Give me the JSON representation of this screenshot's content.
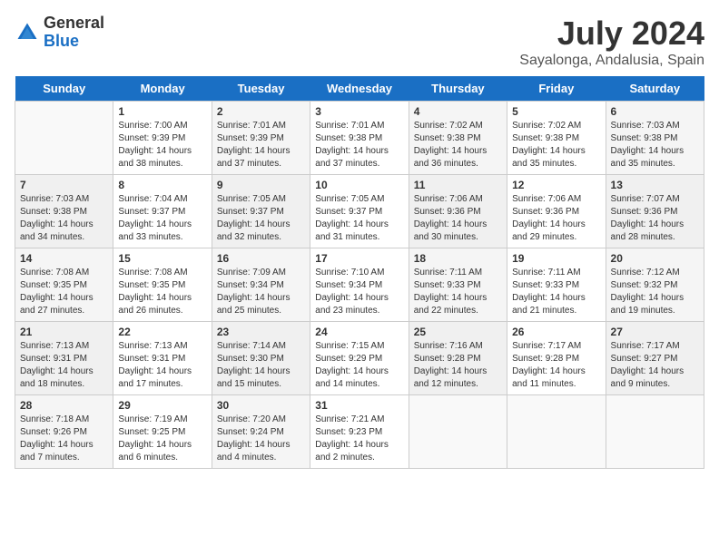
{
  "header": {
    "logo_general": "General",
    "logo_blue": "Blue",
    "title": "July 2024",
    "subtitle": "Sayalonga, Andalusia, Spain"
  },
  "weekdays": [
    "Sunday",
    "Monday",
    "Tuesday",
    "Wednesday",
    "Thursday",
    "Friday",
    "Saturday"
  ],
  "weeks": [
    [
      {
        "day": "",
        "info": ""
      },
      {
        "day": "1",
        "info": "Sunrise: 7:00 AM\nSunset: 9:39 PM\nDaylight: 14 hours\nand 38 minutes."
      },
      {
        "day": "2",
        "info": "Sunrise: 7:01 AM\nSunset: 9:39 PM\nDaylight: 14 hours\nand 37 minutes."
      },
      {
        "day": "3",
        "info": "Sunrise: 7:01 AM\nSunset: 9:38 PM\nDaylight: 14 hours\nand 37 minutes."
      },
      {
        "day": "4",
        "info": "Sunrise: 7:02 AM\nSunset: 9:38 PM\nDaylight: 14 hours\nand 36 minutes."
      },
      {
        "day": "5",
        "info": "Sunrise: 7:02 AM\nSunset: 9:38 PM\nDaylight: 14 hours\nand 35 minutes."
      },
      {
        "day": "6",
        "info": "Sunrise: 7:03 AM\nSunset: 9:38 PM\nDaylight: 14 hours\nand 35 minutes."
      }
    ],
    [
      {
        "day": "7",
        "info": "Sunrise: 7:03 AM\nSunset: 9:38 PM\nDaylight: 14 hours\nand 34 minutes."
      },
      {
        "day": "8",
        "info": "Sunrise: 7:04 AM\nSunset: 9:37 PM\nDaylight: 14 hours\nand 33 minutes."
      },
      {
        "day": "9",
        "info": "Sunrise: 7:05 AM\nSunset: 9:37 PM\nDaylight: 14 hours\nand 32 minutes."
      },
      {
        "day": "10",
        "info": "Sunrise: 7:05 AM\nSunset: 9:37 PM\nDaylight: 14 hours\nand 31 minutes."
      },
      {
        "day": "11",
        "info": "Sunrise: 7:06 AM\nSunset: 9:36 PM\nDaylight: 14 hours\nand 30 minutes."
      },
      {
        "day": "12",
        "info": "Sunrise: 7:06 AM\nSunset: 9:36 PM\nDaylight: 14 hours\nand 29 minutes."
      },
      {
        "day": "13",
        "info": "Sunrise: 7:07 AM\nSunset: 9:36 PM\nDaylight: 14 hours\nand 28 minutes."
      }
    ],
    [
      {
        "day": "14",
        "info": "Sunrise: 7:08 AM\nSunset: 9:35 PM\nDaylight: 14 hours\nand 27 minutes."
      },
      {
        "day": "15",
        "info": "Sunrise: 7:08 AM\nSunset: 9:35 PM\nDaylight: 14 hours\nand 26 minutes."
      },
      {
        "day": "16",
        "info": "Sunrise: 7:09 AM\nSunset: 9:34 PM\nDaylight: 14 hours\nand 25 minutes."
      },
      {
        "day": "17",
        "info": "Sunrise: 7:10 AM\nSunset: 9:34 PM\nDaylight: 14 hours\nand 23 minutes."
      },
      {
        "day": "18",
        "info": "Sunrise: 7:11 AM\nSunset: 9:33 PM\nDaylight: 14 hours\nand 22 minutes."
      },
      {
        "day": "19",
        "info": "Sunrise: 7:11 AM\nSunset: 9:33 PM\nDaylight: 14 hours\nand 21 minutes."
      },
      {
        "day": "20",
        "info": "Sunrise: 7:12 AM\nSunset: 9:32 PM\nDaylight: 14 hours\nand 19 minutes."
      }
    ],
    [
      {
        "day": "21",
        "info": "Sunrise: 7:13 AM\nSunset: 9:31 PM\nDaylight: 14 hours\nand 18 minutes."
      },
      {
        "day": "22",
        "info": "Sunrise: 7:13 AM\nSunset: 9:31 PM\nDaylight: 14 hours\nand 17 minutes."
      },
      {
        "day": "23",
        "info": "Sunrise: 7:14 AM\nSunset: 9:30 PM\nDaylight: 14 hours\nand 15 minutes."
      },
      {
        "day": "24",
        "info": "Sunrise: 7:15 AM\nSunset: 9:29 PM\nDaylight: 14 hours\nand 14 minutes."
      },
      {
        "day": "25",
        "info": "Sunrise: 7:16 AM\nSunset: 9:28 PM\nDaylight: 14 hours\nand 12 minutes."
      },
      {
        "day": "26",
        "info": "Sunrise: 7:17 AM\nSunset: 9:28 PM\nDaylight: 14 hours\nand 11 minutes."
      },
      {
        "day": "27",
        "info": "Sunrise: 7:17 AM\nSunset: 9:27 PM\nDaylight: 14 hours\nand 9 minutes."
      }
    ],
    [
      {
        "day": "28",
        "info": "Sunrise: 7:18 AM\nSunset: 9:26 PM\nDaylight: 14 hours\nand 7 minutes."
      },
      {
        "day": "29",
        "info": "Sunrise: 7:19 AM\nSunset: 9:25 PM\nDaylight: 14 hours\nand 6 minutes."
      },
      {
        "day": "30",
        "info": "Sunrise: 7:20 AM\nSunset: 9:24 PM\nDaylight: 14 hours\nand 4 minutes."
      },
      {
        "day": "31",
        "info": "Sunrise: 7:21 AM\nSunset: 9:23 PM\nDaylight: 14 hours\nand 2 minutes."
      },
      {
        "day": "",
        "info": ""
      },
      {
        "day": "",
        "info": ""
      },
      {
        "day": "",
        "info": ""
      }
    ]
  ]
}
